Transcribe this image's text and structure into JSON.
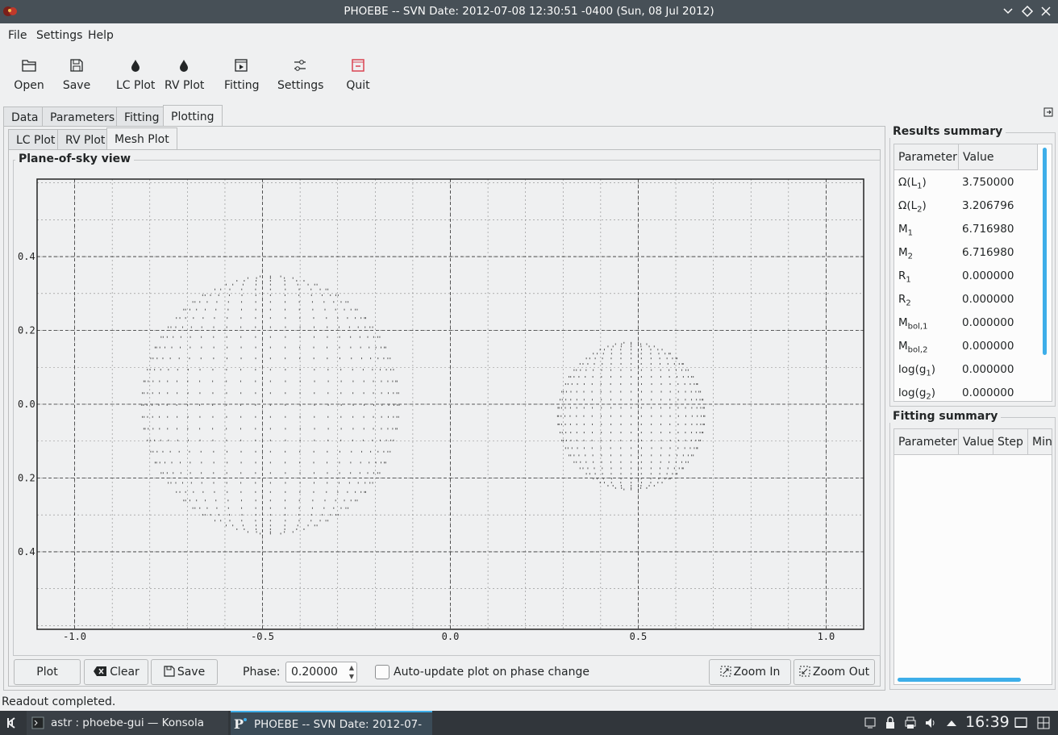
{
  "window": {
    "title": "PHOEBE -- SVN Date: 2012-07-08 12:30:51 -0400 (Sun, 08 Jul 2012)",
    "controls": [
      "chevron-down-icon",
      "diamond-icon",
      "close-icon"
    ]
  },
  "menu": {
    "file": "File",
    "settings": "Settings",
    "help": "Help"
  },
  "toolbar": {
    "open": "Open",
    "save": "Save",
    "lc_plot": "LC Plot",
    "rv_plot": "RV Plot",
    "fitting": "Fitting",
    "settings": "Settings",
    "quit": "Quit"
  },
  "main_tabs": [
    "Data",
    "Parameters",
    "Fitting",
    "Plotting"
  ],
  "sub_tabs": [
    "LC Plot",
    "RV Plot",
    "Mesh Plot"
  ],
  "plot": {
    "group_title": "Plane-of-sky view",
    "x_ticks": [
      "-1.0",
      "-0.5",
      "0.0",
      "0.5",
      "1.0"
    ],
    "y_ticks": [
      "0.4",
      "0.2",
      "0.0",
      "0.2",
      "0.4"
    ]
  },
  "chart_data": {
    "type": "scatter",
    "title": "",
    "xlabel": "",
    "ylabel": "",
    "xlim": [
      -1.1,
      1.1
    ],
    "ylim": [
      -0.61,
      0.61
    ],
    "x_tick_values": [
      -1.0,
      -0.5,
      0.0,
      0.5,
      1.0
    ],
    "y_tick_values": [
      0.4,
      0.2,
      0.0,
      -0.2,
      -0.4
    ],
    "grid": true,
    "point_color": "#555555",
    "series": [
      {
        "center": [
          -0.48,
          0.0
        ],
        "radius": 0.35
      },
      {
        "center": [
          0.48,
          -0.03
        ],
        "radius": 0.2
      }
    ]
  },
  "bottom": {
    "plot": "Plot",
    "clear": "Clear",
    "save": "Save",
    "phase_label": "Phase:",
    "phase_value": "0.20000",
    "auto_update": "Auto-update plot on phase change",
    "zoom_in": "Zoom In",
    "zoom_out": "Zoom Out"
  },
  "results": {
    "title": "Results summary",
    "headers": [
      "Parameter",
      "Value"
    ],
    "rows": [
      {
        "name": "Ω(L",
        "sub": "1",
        "suffix": ")",
        "value": "3.750000"
      },
      {
        "name": "Ω(L",
        "sub": "2",
        "suffix": ")",
        "value": "3.206796"
      },
      {
        "name": "M",
        "sub": "1",
        "suffix": "",
        "value": "6.716980"
      },
      {
        "name": "M",
        "sub": "2",
        "suffix": "",
        "value": "6.716980"
      },
      {
        "name": "R",
        "sub": "1",
        "suffix": "",
        "value": "0.000000"
      },
      {
        "name": "R",
        "sub": "2",
        "suffix": "",
        "value": "0.000000"
      },
      {
        "name": "M",
        "sub": "bol,1",
        "suffix": "",
        "value": "0.000000"
      },
      {
        "name": "M",
        "sub": "bol,2",
        "suffix": "",
        "value": "0.000000"
      },
      {
        "name": "log(g",
        "sub": "1",
        "suffix": ")",
        "value": "0.000000"
      },
      {
        "name": "log(g",
        "sub": "2",
        "suffix": ")",
        "value": "0.000000"
      }
    ]
  },
  "fitting": {
    "title": "Fitting summary",
    "headers": [
      "Parameter",
      "Value",
      "Step",
      "Min"
    ]
  },
  "status": "Readout completed.",
  "taskbar": {
    "konsole": "astr : phoebe-gui — Konsola",
    "phoebe": "PHOEBE -- SVN Date: 2012-07-08 ...",
    "clock": "16:39"
  },
  "colors": {
    "accent": "#3daee9",
    "quit_icon": "#da4453"
  }
}
